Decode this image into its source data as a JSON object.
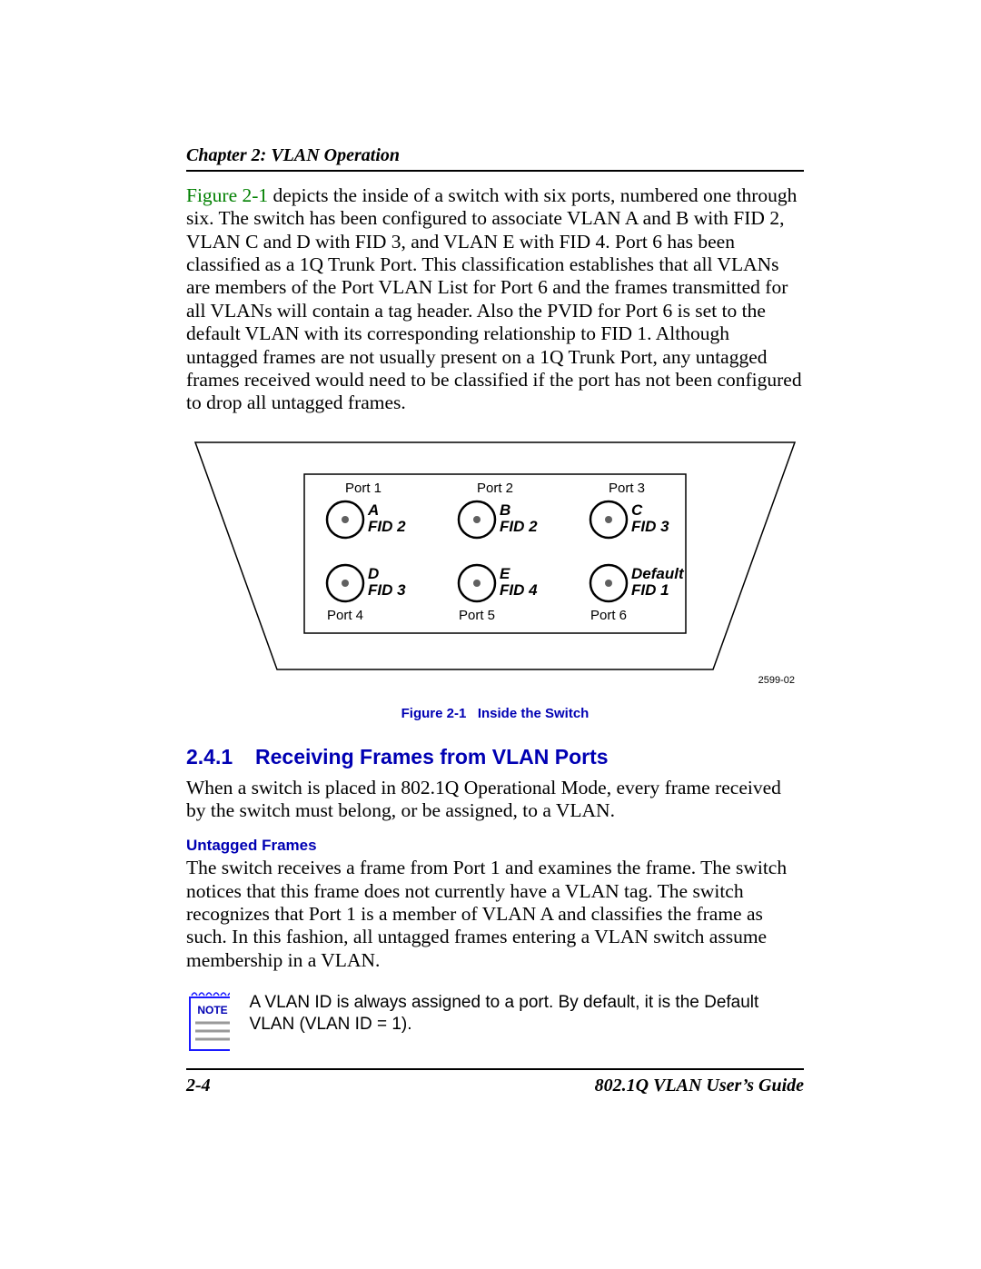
{
  "header": {
    "chapter_label": "Chapter 2: VLAN Operation"
  },
  "intro": {
    "figref": "Figure 2-1",
    "rest": " depicts the inside of a switch with six ports, numbered one through six. The switch has been configured to associate VLAN A and B with FID 2, VLAN C and D with FID 3, and VLAN E with FID 4. Port 6 has been classified as a 1Q Trunk Port. This classification establishes that all VLANs are members of the Port VLAN List for Port 6 and the frames transmitted for all VLANs will contain a tag header. Also the PVID for Port 6 is set to the default VLAN with its corresponding relationship to FID 1. Although untagged frames are not usually present on a 1Q Trunk Port, any untagged frames received would need to be classified if the port has not been configured to drop all untagged frames."
  },
  "figure": {
    "caption_label": "Figure 2-1",
    "caption_title": "Inside the Switch",
    "diagram_code": "2599-02",
    "ports": {
      "p1": {
        "port": "Port 1",
        "vlan": "A",
        "fid": "FID 2"
      },
      "p2": {
        "port": "Port 2",
        "vlan": "B",
        "fid": "FID 2"
      },
      "p3": {
        "port": "Port 3",
        "vlan": "C",
        "fid": "FID 3"
      },
      "p4": {
        "port": "Port 4",
        "vlan": "D",
        "fid": "FID 3"
      },
      "p5": {
        "port": "Port 5",
        "vlan": "E",
        "fid": "FID 4"
      },
      "p6": {
        "port": "Port 6",
        "vlan": "Default",
        "fid": "FID 1"
      }
    }
  },
  "section": {
    "number": "2.4.1",
    "title": "Receiving Frames from VLAN Ports",
    "intro": "When a switch is placed in 802.1Q Operational Mode, every frame received by the switch must belong, or be assigned, to a VLAN.",
    "sub1_title": "Untagged Frames",
    "sub1_body": "The switch receives a frame from Port 1 and examines the frame. The switch notices that this frame does not currently have a VLAN tag. The switch recognizes that Port 1 is a member of VLAN A and classifies the frame as such. In this fashion, all untagged frames entering a VLAN switch assume membership in a VLAN."
  },
  "note": {
    "label": "NOTE",
    "text": "A VLAN ID is always assigned to a port. By default, it is the Default VLAN (VLAN ID = 1)."
  },
  "footer": {
    "page": "2-4",
    "guide": "802.1Q VLAN User’s Guide"
  }
}
